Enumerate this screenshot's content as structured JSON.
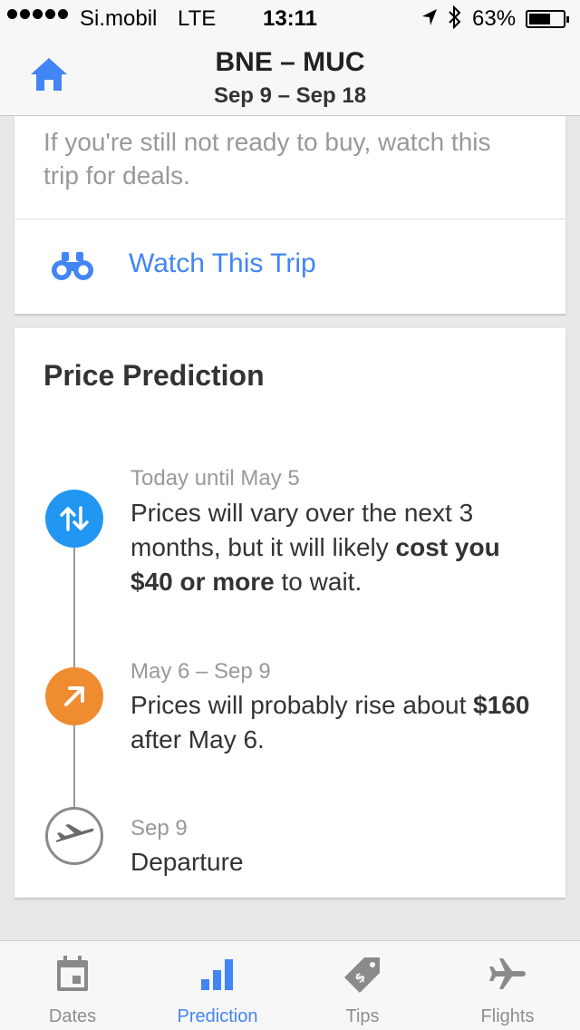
{
  "status": {
    "carrier": "Si.mobil",
    "network": "LTE",
    "time": "13:11",
    "battery_pct": "63%",
    "battery_level": 0.63
  },
  "header": {
    "route": "BNE – MUC",
    "dates": "Sep 9 – Sep 18"
  },
  "watch_card": {
    "text": "If you're still not ready to buy, watch this trip for deals.",
    "button_label": "Watch This Trip"
  },
  "prediction": {
    "title": "Price Prediction",
    "items": [
      {
        "date": "Today until May 5",
        "text_a": "Prices will vary over the next 3 months, but it will likely ",
        "text_bold": "cost you $40 or more",
        "text_b": " to wait.",
        "icon": "vary-arrows-icon",
        "color": "#2196f3"
      },
      {
        "date": "May 6 – Sep 9",
        "text_a": "Prices will probably rise about ",
        "text_bold": "$160",
        "text_b": " after May 6.",
        "icon": "rise-arrow-icon",
        "color": "#f08c30"
      },
      {
        "date": "Sep 9",
        "text_a": "Departure",
        "icon": "airplane-icon",
        "color": "#8a8a8a"
      }
    ]
  },
  "tabs": [
    {
      "label": "Dates",
      "icon": "calendar-icon",
      "active": false
    },
    {
      "label": "Prediction",
      "icon": "bar-chart-icon",
      "active": true
    },
    {
      "label": "Tips",
      "icon": "price-tag-icon",
      "active": false
    },
    {
      "label": "Flights",
      "icon": "airplane-icon",
      "active": false
    }
  ],
  "colors": {
    "accent": "#4285f4",
    "vary": "#2196f3",
    "rise": "#f08c30",
    "muted": "#999999"
  }
}
